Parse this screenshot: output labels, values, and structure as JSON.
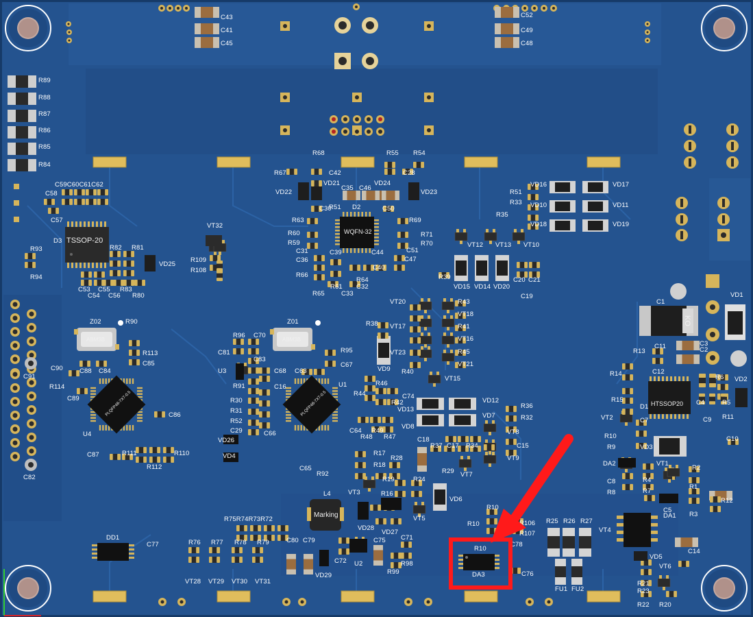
{
  "view": "3D PCB Board View",
  "ic_markings": {
    "tssop": "TSSOP-20",
    "wqfn": "WQFN-32",
    "htssop": "HTSSOP20",
    "inductor": "Marking",
    "crystal": "ABM3B",
    "qfp": "PLQFP48-7X7-0.5",
    "ko": "KO"
  },
  "designators": {
    "top_caps_left": [
      "C43",
      "C41",
      "C45"
    ],
    "top_caps_right": [
      "C52",
      "C49",
      "C48"
    ],
    "left_res": [
      "R89",
      "R88",
      "R87",
      "R86",
      "R85",
      "R84"
    ],
    "parts": [
      "R68",
      "R67",
      "C42",
      "VD21",
      "R55",
      "R54",
      "C28",
      "VD22",
      "C35",
      "C46",
      "VD24",
      "VD23",
      "R51",
      "C30",
      "D2",
      "C50",
      "R63",
      "R69",
      "R60",
      "R71",
      "R59",
      "R70",
      "C31",
      "C39",
      "C44",
      "C47",
      "C36",
      "C40",
      "R66",
      "R64",
      "R61",
      "C32",
      "R65",
      "C33",
      "C59",
      "C60",
      "C61",
      "C62",
      "C58",
      "C57",
      "D3",
      "R93",
      "R94",
      "R82",
      "R81",
      "VD25",
      "C53",
      "C55",
      "R83",
      "C54",
      "C56",
      "R80",
      "VT32",
      "R109",
      "R108",
      "VD16",
      "VD17",
      "R33",
      "VD10",
      "VD11",
      "R35",
      "VD18",
      "VD19",
      "R51",
      "VT12",
      "VT13",
      "VT10",
      "R39",
      "VD15",
      "VD14",
      "VD20",
      "C20",
      "C21",
      "C19",
      "VT20",
      "R43",
      "VT18",
      "R38",
      "VT17",
      "R41",
      "VT16",
      "VD9",
      "VT23",
      "R45",
      "VT21",
      "R40",
      "VT15",
      "Z02",
      "R90",
      "Z01",
      "R96",
      "C70",
      "R95",
      "C81",
      "C83",
      "C67",
      "R113",
      "C85",
      "C90",
      "C88",
      "C84",
      "R114",
      "C89",
      "U3",
      "C68",
      "C63",
      "R91",
      "C16",
      "U1",
      "R30",
      "R44",
      "R46",
      "R31",
      "R52",
      "R42",
      "C74",
      "VD12",
      "R36",
      "VD13",
      "R32",
      "C29",
      "C66",
      "C64",
      "R48",
      "R49",
      "R47",
      "VD8",
      "VD7",
      "VT8",
      "U4",
      "C86",
      "VD26",
      "VD4",
      "C87",
      "R111",
      "R110",
      "R112",
      "C91",
      "C82",
      "C18",
      "R37",
      "C17",
      "R34",
      "C15",
      "R17",
      "R28",
      "R18",
      "R29",
      "VT7",
      "VT9",
      "C65",
      "R92",
      "R19",
      "R24",
      "L4",
      "VT3",
      "R16",
      "VD6",
      "VD28",
      "VD27",
      "VT5",
      "R75",
      "R74",
      "R73",
      "R72",
      "DD1",
      "C77",
      "R76",
      "R77",
      "R78",
      "R79",
      "C80",
      "C79",
      "C72",
      "C75",
      "C71",
      "U2",
      "R98",
      "R99",
      "VD29",
      "VT28",
      "VT29",
      "VT30",
      "VT31",
      "R10",
      "R106",
      "R107",
      "C78",
      "DA3",
      "C76",
      "R25",
      "R26",
      "R27",
      "FU1",
      "FU2",
      "VT4",
      "VD5",
      "C14",
      "C5",
      "DA1",
      "R3",
      "R1",
      "R2",
      "R12",
      "C1",
      "VD1",
      "C3",
      "C2",
      "C11",
      "R13",
      "C12",
      "VD2",
      "R14",
      "R6",
      "C4",
      "R5",
      "D1",
      "R15",
      "C9",
      "VT2",
      "C7",
      "R11",
      "C10",
      "R10",
      "R9",
      "VD3",
      "DA2",
      "VT1",
      "C8",
      "R4",
      "R8",
      "VT6",
      "R7",
      "R21",
      "R23",
      "R22",
      "R20"
    ]
  },
  "annotation": {
    "target": "DA3",
    "color": "#ff1a1a"
  },
  "colors": {
    "board": "#24538f",
    "copper": "#d7b45a",
    "silk": "#ffffff",
    "annotation": "#ff1a1a"
  }
}
